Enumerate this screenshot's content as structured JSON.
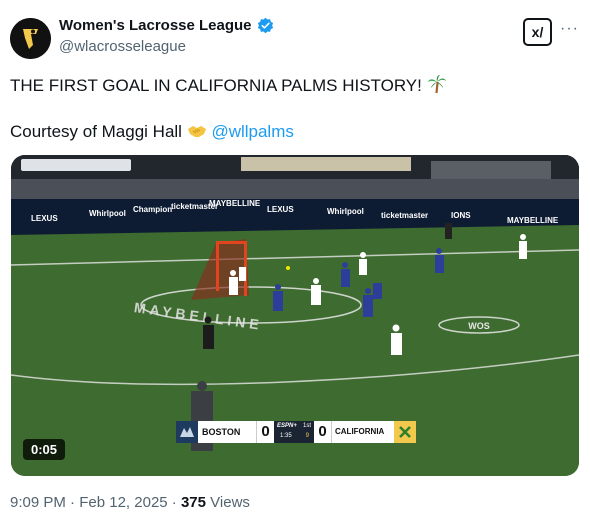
{
  "author": {
    "display_name": "Women's Lacrosse League",
    "handle": "@wlacrosseleague",
    "avatar_icon": "wll-logo-icon",
    "verified_icon": "verified-badge-icon"
  },
  "actions": {
    "grok_label": "x/",
    "more_label": "···"
  },
  "post": {
    "line1": "THE FIRST GOAL IN CALIFORNIA PALMS HISTORY!",
    "line1_emoji": "palm-tree-icon",
    "line2_prefix": "Courtesy of Maggi Hall",
    "line2_emoji": "handshake-icon",
    "mention": "@wllpalms"
  },
  "media": {
    "duration": "0:05",
    "scorebug": {
      "home_team": "BOSTON",
      "home_score": "0",
      "network": "ESPN+",
      "period": "1st",
      "clock": "1:35",
      "shot_clock": "9",
      "away_team": "CALIFORNIA",
      "away_score": "0"
    },
    "sponsor_boards": [
      "LEXUS",
      "Whirlpool",
      "Champion",
      "ticketmaster",
      "MAYBELLINE",
      "LEXUS",
      "Whirlpool",
      "ticketmaster",
      "IONS",
      "MAYBELLINE"
    ],
    "field_text": "MAYBELLINE",
    "field_circle_text": "WOS",
    "colors": {
      "field": "#3e6b2f",
      "board": "#0d1c33",
      "scorebug_bg": "#1b2433"
    }
  },
  "footer": {
    "time": "9:09 PM",
    "separator": " · ",
    "date": "Feb 12, 2025",
    "views_count": "375",
    "views_label": "Views"
  }
}
